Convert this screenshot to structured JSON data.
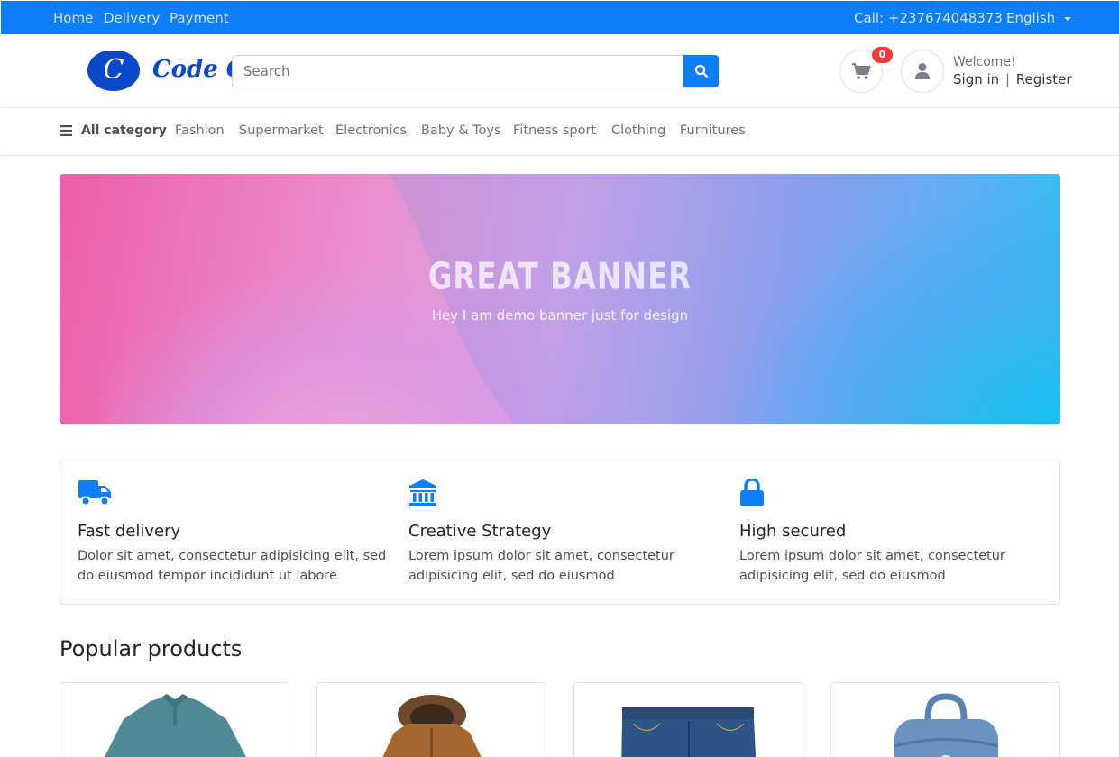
{
  "topbar": {
    "links": [
      "Home",
      "Delivery",
      "Payment"
    ],
    "call": "Call: +237674048373",
    "language": "English"
  },
  "header": {
    "logo_letter": "C",
    "logo_text": "Code Gu",
    "search_placeholder": "Search",
    "cart_count": "0",
    "welcome": "Welcome!",
    "sign_in": "Sign in",
    "separator": "|",
    "register": "Register"
  },
  "categories": {
    "all": "All category",
    "items": [
      "Fashion",
      "Supermarket",
      "Electronics",
      "Baby & Toys",
      "Fitness sport",
      "Clothing",
      "Furnitures"
    ]
  },
  "banner": {
    "title": "GREAT BANNER",
    "subtitle": "Hey I am demo banner just for design"
  },
  "features": [
    {
      "icon": "truck-icon",
      "title": "Fast delivery",
      "text": "Dolor sit amet, consectetur adipisicing elit, sed do eiusmod tempor incididunt ut labore"
    },
    {
      "icon": "bank-icon",
      "title": "Creative Strategy",
      "text": "Lorem ipsum dolor sit amet, consectetur adipisicing elit, sed do eiusmod"
    },
    {
      "icon": "lock-icon",
      "title": "High secured",
      "text": "Lorem ipsum dolor sit amet, consectetur adipisicing elit, sed do eiusmod"
    }
  ],
  "popular": {
    "title": "Popular products",
    "products": [
      "polo-shirt-image",
      "jacket-image",
      "jeans-image",
      "backpack-image"
    ]
  },
  "colors": {
    "primary": "#0d7ef7",
    "badge": "#ef3b3b",
    "logo": "#0b47c9"
  }
}
